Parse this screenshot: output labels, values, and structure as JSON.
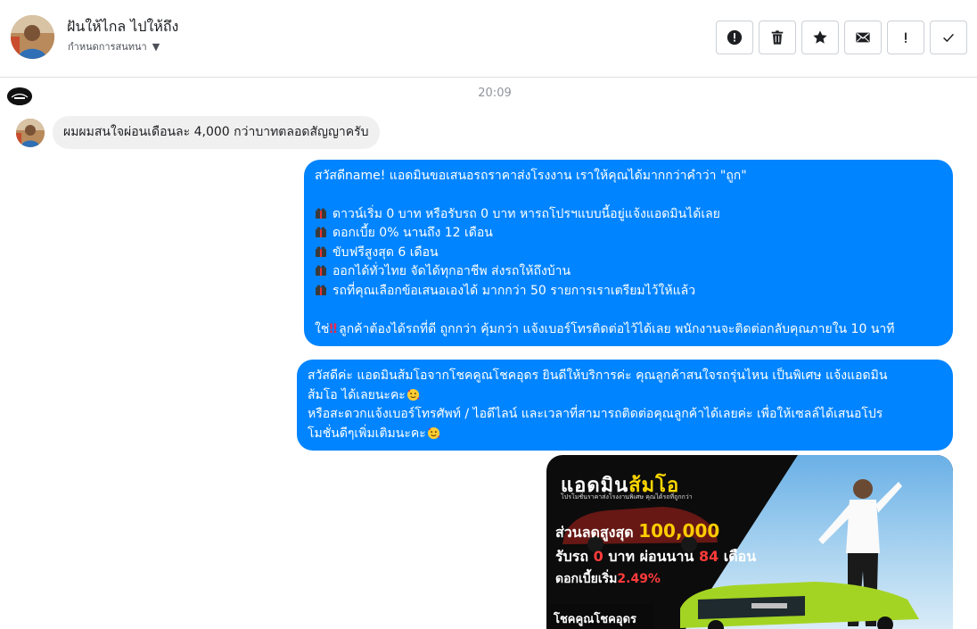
{
  "header": {
    "title": "ฝันให้ไกล ไปให้ถึง",
    "subtitle": "กำหนดการสนทนา",
    "actions": [
      {
        "name": "report-button",
        "icon": "alert-circle-icon"
      },
      {
        "name": "delete-button",
        "icon": "trash-icon"
      },
      {
        "name": "star-button",
        "icon": "star-icon"
      },
      {
        "name": "mark-unread-button",
        "icon": "envelope-icon"
      },
      {
        "name": "important-button",
        "icon": "exclamation-icon"
      },
      {
        "name": "done-button",
        "icon": "check-icon"
      }
    ]
  },
  "conversation": {
    "timestamp": "20:09",
    "incoming": {
      "text": "ผมผมสนใจผ่อนเดือนละ 4,000 กว่าบาทตลอดสัญญาครับ"
    },
    "outgoing_1": {
      "greeting": "สวัสดีname! แอดมินขอเสนอรถราคาส่งโรงงาน เราให้คุณได้มากกว่าคำว่า \"ถูก\"",
      "bullets": [
        "ดาวน์เริ่ม 0 บาท หรือรับรถ 0 บาท หารถโปรฯแบบนี้อยู่แจ้งแอดมินได้เลย",
        "ดอกเบี้ย 0% นานถึง 12 เดือน",
        "ขับฟรีสูงสุด 6 เดือน",
        "ออกได้ทั่วไทย จัดได้ทุกอาชีพ ส่งรถให้ถึงบ้าน",
        "รถที่คุณเลือกข้อเสนอเองได้ มากกว่า 50 รายการเราเตรียมไว้ให้แล้ว"
      ],
      "closing_prefix": "ใช่",
      "closing_text": "ลูกค้าต้องได้รถที่ดี ถูกกว่า คุ้มกว่า แจ้งเบอร์โทรติดต่อไว้ได้เลย พนักงานจะติดต่อกลับคุณภายใน 10 นาที"
    },
    "outgoing_2": {
      "line1": "สวัสดีค่ะ แอดมินส้มโอจากโชคคูณโชคอุดร ยินดีให้บริการค่ะ   คุณลูกค้าสนใจรถรุ่นไหน เป็นพิเศษ แจ้งแอดมิน",
      "line2": "ส้มโอ ได้เลยนะคะ",
      "line3": "หรือสะดวกแจ้งเบอร์โทรศัพท์ / ไอดีไลน์ และเวลาที่สามารถติดต่อคุณลูกค้าได้เลยค่ะ เพื่อให้เซลล์ได้เสนอโปร",
      "line4": "โมชั่นดีๆเพิ่มเติมนะคะ"
    },
    "image_message": {
      "title_a": "แอดมิน",
      "title_b": "ส้มโอ",
      "subtitle": "โปรโมชั่นราคาส่งโรงงานพิเศษ คุณได้รถที่ถูกกว่า",
      "discount_label": "ส่วนลดสูงสุด",
      "discount_value": "100,000",
      "line2_a": "รับรถ",
      "line2_b": "0",
      "line2_c": "บาท ผ่อนนาน",
      "line2_d": "84",
      "line2_e": "เดือน",
      "rate_label": "ดอกเบี้ยเริ่ม",
      "rate_value": "2.49%",
      "badge": "โชคคูณโชคอุดร"
    }
  },
  "colors": {
    "outgoing_bubble": "#0084ff",
    "incoming_bubble": "#f1f0f0",
    "timestamp": "#90949c"
  }
}
